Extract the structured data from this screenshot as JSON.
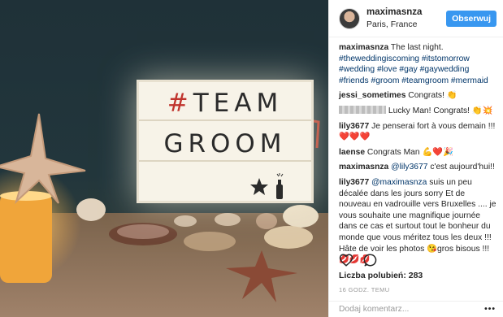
{
  "post": {
    "photo": {
      "lightbox_line1_hash": "#",
      "lightbox_line1_word": "TEAM",
      "lightbox_line2": "GROOM"
    }
  },
  "header": {
    "username": "maximasnza",
    "location": "Paris, France",
    "follow_label": "Obserwuj"
  },
  "comments": [
    {
      "user": "maximasnza",
      "text": " The last night. ",
      "tags": "#theweddingiscoming #itstomorrow #wedding #love #gay #gaywedding #friends #groom #teamgroom #mermaid"
    },
    {
      "user": "jessi_sometimes",
      "text": " Congrats! 👏"
    },
    {
      "user": "",
      "text": " Lucky Man! Congrats! 👏💥"
    },
    {
      "user": "lily3677",
      "text": " Je penserai fort à vous demain !!! ❤️❤️❤️"
    },
    {
      "user": "laense",
      "text": " Congrats Man 💪❤️🎉"
    },
    {
      "user": "maximasnza",
      "mention": " @lily3677",
      "text": " c'est aujourd'hui!!"
    },
    {
      "user": "lily3677",
      "mention": " @maximasnza",
      "text": " suis un peu décalée dans les jours sorry Et de nouveau en vadrouille vers Bruxelles .... je vous souhaite une magnifique journée dans ce cas et surtout tout le bonheur du monde que vous méritez tous les deux !!! Hâte de voir les photos 😘gros bisous !!!💋💋💋"
    }
  ],
  "actions": {
    "like_icon": "heart-icon",
    "comment_icon": "comment-bubble-icon"
  },
  "likes_text": "Liczba polubień: 283",
  "timestamp": "16 GODZ. TEMU",
  "add_comment_placeholder": "Dodaj komentarz...",
  "more_label": "•••",
  "colors": {
    "follow": "#3897f0",
    "hashtag": "#003569",
    "lightbox_hash": "#c0342d"
  }
}
